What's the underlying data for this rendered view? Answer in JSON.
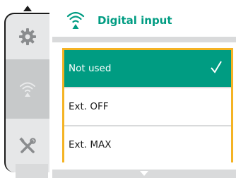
{
  "header": {
    "title": "Digital input",
    "icon": "wifi-signal-icon"
  },
  "nav": {
    "up_icon": "chevron-up-icon",
    "down_icon": "chevron-down-icon",
    "items": [
      {
        "icon": "gear-icon",
        "active": false
      },
      {
        "icon": "wifi-signal-icon",
        "active": true
      },
      {
        "icon": "tools-icon",
        "active": false
      }
    ]
  },
  "options": [
    {
      "label": "Not used",
      "selected": true
    },
    {
      "label": "Ext. OFF",
      "selected": false
    },
    {
      "label": "Ext. MAX",
      "selected": false
    }
  ],
  "colors": {
    "accent": "#009c82",
    "focus": "#f4b324",
    "rail": "#e6e7e8",
    "rail_active": "#c7c9ca"
  }
}
